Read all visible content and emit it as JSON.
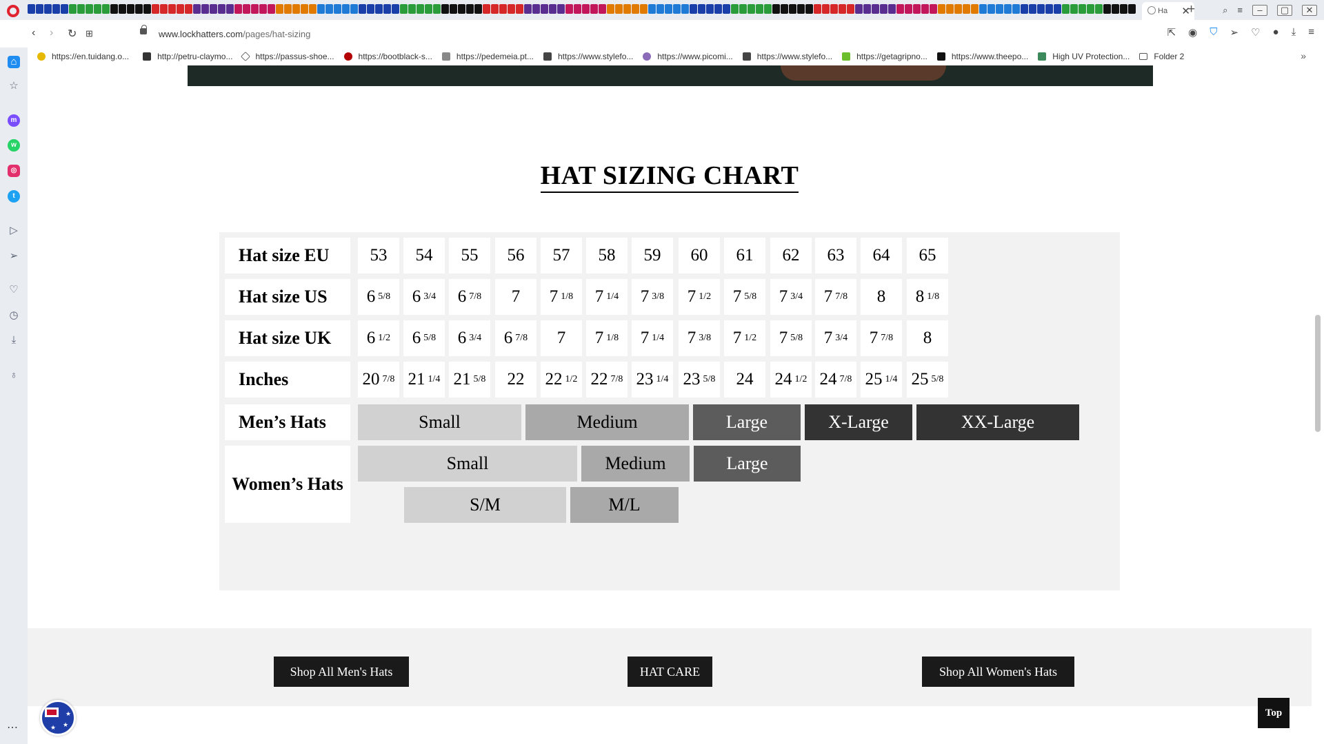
{
  "browser": {
    "url_host": "www.lockhatters.com",
    "url_path": "/pages/hat-sizing",
    "tab_title": "Ha",
    "bookmarks": [
      "https://en.tuidang.o...",
      "http://petru-claymo...",
      "https://passus-shoe...",
      "https://bootblack-s...",
      "https://pedemeia.pt...",
      "https://www.stylefo...",
      "https://www.picomi...",
      "https://www.stylefo...",
      "https://getagripno...",
      "https://www.theepo...",
      "High UV Protection...",
      "Folder 2"
    ]
  },
  "page": {
    "title": "HAT SIZING CHART",
    "rows": {
      "eu_label": "Hat size EU",
      "us_label": "Hat size US",
      "uk_label": "Hat size UK",
      "inches_label": "Inches",
      "mens_label": "Men’s Hats",
      "womens_label": "Women’s Hats"
    },
    "eu": [
      "53",
      "54",
      "55",
      "56",
      "57",
      "58",
      "59",
      "60",
      "61",
      "62",
      "63",
      "64",
      "65"
    ],
    "us": [
      {
        "whole": "6",
        "frac": "5/8"
      },
      {
        "whole": "6",
        "frac": "3/4"
      },
      {
        "whole": "6",
        "frac": "7/8"
      },
      {
        "whole": "7",
        "frac": ""
      },
      {
        "whole": "7",
        "frac": "1/8"
      },
      {
        "whole": "7",
        "frac": "1/4"
      },
      {
        "whole": "7",
        "frac": "3/8"
      },
      {
        "whole": "7",
        "frac": "1/2"
      },
      {
        "whole": "7",
        "frac": "5/8"
      },
      {
        "whole": "7",
        "frac": "3/4"
      },
      {
        "whole": "7",
        "frac": "7/8"
      },
      {
        "whole": "8",
        "frac": ""
      },
      {
        "whole": "8",
        "frac": "1/8"
      }
    ],
    "uk": [
      {
        "whole": "6",
        "frac": "1/2"
      },
      {
        "whole": "6",
        "frac": "5/8"
      },
      {
        "whole": "6",
        "frac": "3/4"
      },
      {
        "whole": "6",
        "frac": "7/8"
      },
      {
        "whole": "7",
        "frac": ""
      },
      {
        "whole": "7",
        "frac": "1/8"
      },
      {
        "whole": "7",
        "frac": "1/4"
      },
      {
        "whole": "7",
        "frac": "3/8"
      },
      {
        "whole": "7",
        "frac": "1/2"
      },
      {
        "whole": "7",
        "frac": "5/8"
      },
      {
        "whole": "7",
        "frac": "3/4"
      },
      {
        "whole": "7",
        "frac": "7/8"
      },
      {
        "whole": "8",
        "frac": ""
      }
    ],
    "inches": [
      {
        "whole": "20",
        "frac": "7/8"
      },
      {
        "whole": "21",
        "frac": "1/4"
      },
      {
        "whole": "21",
        "frac": "5/8"
      },
      {
        "whole": "22",
        "frac": ""
      },
      {
        "whole": "22",
        "frac": "1/2"
      },
      {
        "whole": "22",
        "frac": "7/8"
      },
      {
        "whole": "23",
        "frac": "1/4"
      },
      {
        "whole": "23",
        "frac": "5/8"
      },
      {
        "whole": "24",
        "frac": ""
      },
      {
        "whole": "24",
        "frac": "1/2"
      },
      {
        "whole": "24",
        "frac": "7/8"
      },
      {
        "whole": "25",
        "frac": "1/4"
      },
      {
        "whole": "25",
        "frac": "5/8"
      }
    ],
    "mens_sizes": [
      "Small",
      "Medium",
      "Large",
      "X-Large",
      "XX-Large"
    ],
    "womens_sizes_row1": [
      "Small",
      "Medium",
      "Large"
    ],
    "womens_sizes_row2": [
      "S/M",
      "M/L"
    ],
    "colors": {
      "light_gray": "#d1d1d1",
      "mid_gray": "#a9a9a9",
      "dark_gray": "#5c5c5c",
      "charcoal": "#333333"
    }
  },
  "footer": {
    "shop_mens": "Shop All Men's Hats",
    "hat_care": "HAT CARE",
    "shop_womens": "Shop All Women's Hats",
    "top": "Top"
  }
}
